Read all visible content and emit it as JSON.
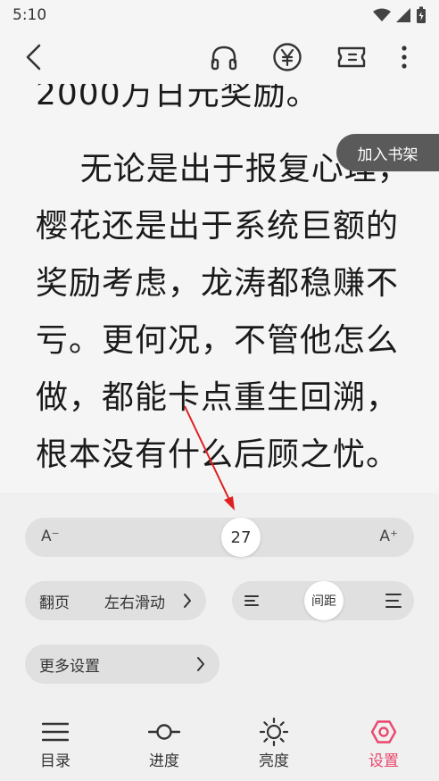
{
  "status_bar": {
    "time": "5:10"
  },
  "reader": {
    "lines": [
      "2000万日元奖励。",
      "    无论是出于报复心理，",
      "樱花还是出于系统巨额的",
      "奖励考虑，龙涛都稳赚不",
      "亏。更何况，不管他怎么",
      "做，都能卡点重生回溯，",
      "根本没有什么后顾之忧。"
    ],
    "bookshelf_label": "加入书架"
  },
  "font_size": {
    "min_label": "A⁻",
    "max_label": "A⁺",
    "value": "27"
  },
  "page_turn": {
    "label": "翻页",
    "value": "左右滑动"
  },
  "spacing": {
    "label": "间距"
  },
  "more_settings": {
    "label": "更多设置"
  },
  "bottom_nav": {
    "items": [
      {
        "label": "目录",
        "icon": "menu-icon"
      },
      {
        "label": "进度",
        "icon": "progress-icon"
      },
      {
        "label": "亮度",
        "icon": "brightness-icon"
      },
      {
        "label": "设置",
        "icon": "settings-icon",
        "active": true
      }
    ]
  },
  "colors": {
    "accent": "#e8476e",
    "annotation": "#e02020"
  }
}
